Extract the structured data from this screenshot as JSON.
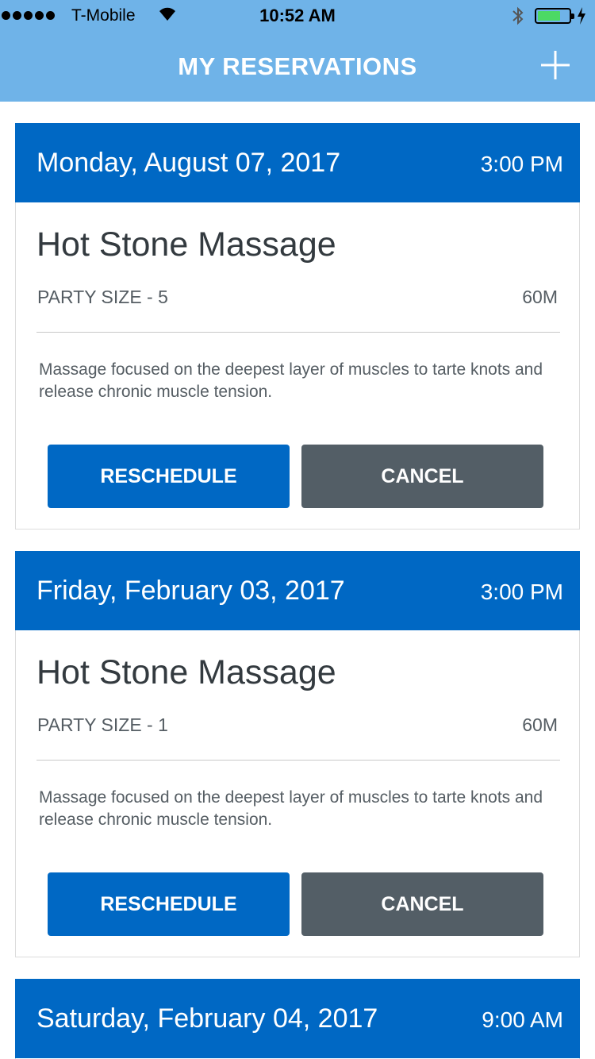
{
  "status_bar": {
    "carrier": "T-Mobile",
    "time": "10:52 AM",
    "battery_color": "#4cd964"
  },
  "header": {
    "title": "MY RESERVATIONS",
    "add_icon": "plus-icon",
    "bg_color": "#6fb3e8"
  },
  "reservations": [
    {
      "date": "Monday, August 07, 2017",
      "time": "3:00 PM",
      "service": "Hot Stone Massage",
      "party_size": "PARTY SIZE - 5",
      "duration": "60M",
      "description": "Massage focused on the deepest layer of muscles to tarte knots and release chronic muscle tension.",
      "reschedule_label": "RESCHEDULE",
      "cancel_label": "CANCEL"
    },
    {
      "date": "Friday, February 03, 2017",
      "time": "3:00 PM",
      "service": "Hot Stone Massage",
      "party_size": "PARTY SIZE - 1",
      "duration": "60M",
      "description": "Massage focused on the deepest layer of muscles to tarte knots and release chronic muscle tension.",
      "reschedule_label": "RESCHEDULE",
      "cancel_label": "CANCEL"
    },
    {
      "date": "Saturday, February 04, 2017",
      "time": "9:00 AM"
    }
  ],
  "colors": {
    "primary": "#0068c4",
    "cancel": "#535e66"
  }
}
